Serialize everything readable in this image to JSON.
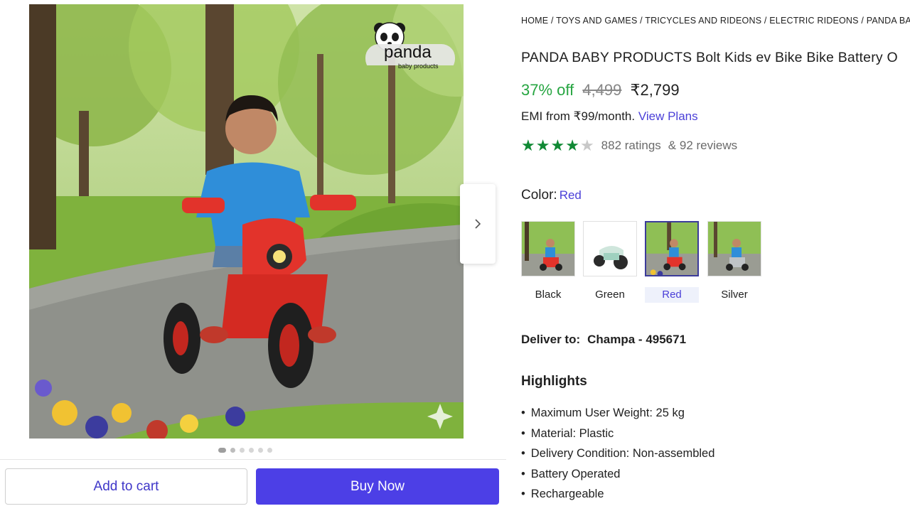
{
  "brand": {
    "logo_word": "panda",
    "logo_sub": "baby products"
  },
  "gallery": {
    "dots_count": 6,
    "active_index": 0
  },
  "actions": {
    "add_to_cart": "Add to cart",
    "buy_now": "Buy Now"
  },
  "breadcrumb": {
    "text": "HOME / TOYS AND GAMES / TRICYCLES AND RIDEONS / ELECTRIC RIDEONS / PANDA BABY"
  },
  "product": {
    "title": "PANDA BABY PRODUCTS Bolt Kids ev Bike Bike Battery O",
    "discount": "37% off",
    "mrp": "4,499",
    "price": "₹2,799",
    "emi_text": "EMI from ₹99/month.",
    "emi_link": "View Plans",
    "rating_stars": 4,
    "ratings_text": "882 ratings",
    "reviews_text": "& 92 reviews"
  },
  "color": {
    "label": "Color:",
    "selected": "Red",
    "options": [
      {
        "name": "Black"
      },
      {
        "name": "Green"
      },
      {
        "name": "Red"
      },
      {
        "name": "Silver"
      }
    ]
  },
  "delivery": {
    "label": "Deliver to:",
    "location": "Champa - 495671"
  },
  "highlights": {
    "title": "Highlights",
    "items": [
      "Maximum User Weight: 25 kg",
      "Material: Plastic",
      "Delivery Condition: Non-assembled",
      "Battery Operated",
      "Rechargeable"
    ]
  },
  "colors": {
    "accent": "#4c3fe6",
    "link": "#4a3fd8",
    "discount_green": "#26a541",
    "star_green": "#108934"
  }
}
